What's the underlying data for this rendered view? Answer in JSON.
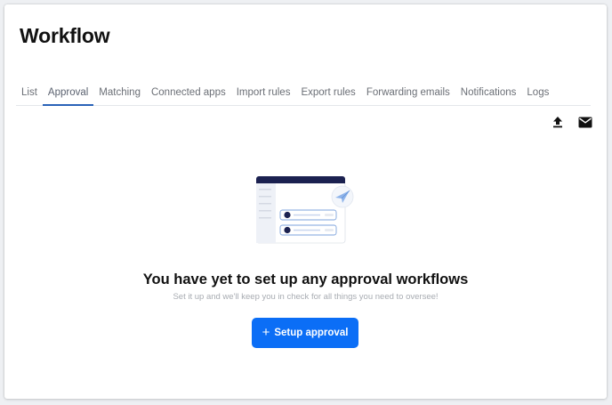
{
  "page": {
    "title": "Workflow"
  },
  "tabs": [
    {
      "label": "List",
      "active": false
    },
    {
      "label": "Approval",
      "active": true
    },
    {
      "label": "Matching",
      "active": false
    },
    {
      "label": "Connected apps",
      "active": false
    },
    {
      "label": "Import rules",
      "active": false
    },
    {
      "label": "Export rules",
      "active": false
    },
    {
      "label": "Forwarding emails",
      "active": false
    },
    {
      "label": "Notifications",
      "active": false
    },
    {
      "label": "Logs",
      "active": false
    }
  ],
  "toolbar": {
    "upload_icon": "upload-icon",
    "email_icon": "email-icon"
  },
  "empty_state": {
    "title": "You have yet to set up any approval workflows",
    "subtitle": "Set it up and we'll keep you in check for all things you need to oversee!",
    "button_label": "Setup approval",
    "button_icon": "plus-icon",
    "illustration": "approval-workflow-illustration"
  },
  "colors": {
    "accent": "#0b6ef6",
    "active_tab_underline": "#2a63b8",
    "illustration_dark": "#1b2150"
  }
}
